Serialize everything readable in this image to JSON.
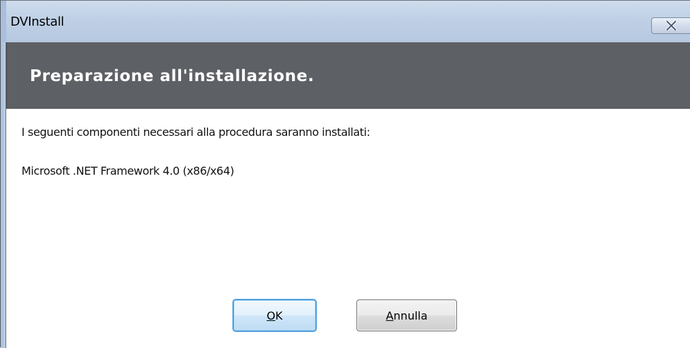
{
  "window": {
    "title": "DVInstall",
    "close_icon": "close-icon"
  },
  "header": {
    "title": "Preparazione all'installazione."
  },
  "content": {
    "intro_text": "I seguenti componenti necessari alla procedura saranno installati:",
    "components": [
      "Microsoft .NET Framework 4.0 (x86/x64)"
    ]
  },
  "buttons": {
    "ok_label": "OK",
    "cancel_label": "Annulla"
  },
  "colors": {
    "header_band": "#5d6064",
    "titlebar": "#bfd0e6",
    "ok_border": "#3c8fd6"
  }
}
